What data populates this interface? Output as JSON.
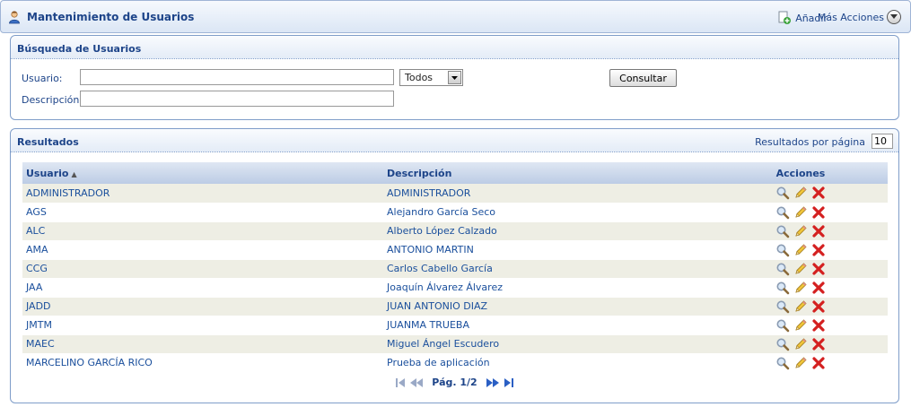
{
  "header": {
    "title": "Mantenimiento de Usuarios",
    "add_label": "Añadir",
    "more_label": "Más Acciones"
  },
  "search": {
    "title": "Búsqueda de Usuarios",
    "user_label": "Usuario:",
    "user_value": "",
    "filter_value": "Todos",
    "description_label": "Descripción:",
    "description_value": "",
    "submit_label": "Consultar"
  },
  "results": {
    "title": "Resultados",
    "per_page_label": "Resultados por página",
    "per_page_value": "10",
    "columns": {
      "user": "Usuario",
      "description": "Descripción",
      "actions": "Acciones"
    },
    "rows": [
      {
        "user": "ADMINISTRADOR",
        "description": "ADMINISTRADOR"
      },
      {
        "user": "AGS",
        "description": "Alejandro García Seco"
      },
      {
        "user": "ALC",
        "description": "Alberto López Calzado"
      },
      {
        "user": "AMA",
        "description": "ANTONIO MARTIN"
      },
      {
        "user": "CCG",
        "description": "Carlos Cabello García"
      },
      {
        "user": "JAA",
        "description": "Joaquín Álvarez Álvarez"
      },
      {
        "user": "JADD",
        "description": "JUAN ANTONIO DIAZ"
      },
      {
        "user": "JMTM",
        "description": "JUANMA TRUEBA"
      },
      {
        "user": "MAEC",
        "description": "Miguel Ángel Escudero"
      },
      {
        "user": "MARCELINO GARCÍA RICO",
        "description": "Prueba de aplicación"
      }
    ],
    "pager_label": "Pág. 1/2"
  },
  "icons": {
    "header": "user-icon",
    "add": "add-icon",
    "more": "chevron-down-icon",
    "view": "magnifier-icon",
    "edit": "pencil-icon",
    "delete": "delete-icon",
    "first": "first-page-icon",
    "prev": "previous-page-icon",
    "next": "next-page-icon",
    "last": "last-page-icon"
  },
  "colors": {
    "accent": "#1d4489",
    "link": "#1a4f9c",
    "row_alt": "#eeeee4",
    "delete": "#d42020"
  }
}
